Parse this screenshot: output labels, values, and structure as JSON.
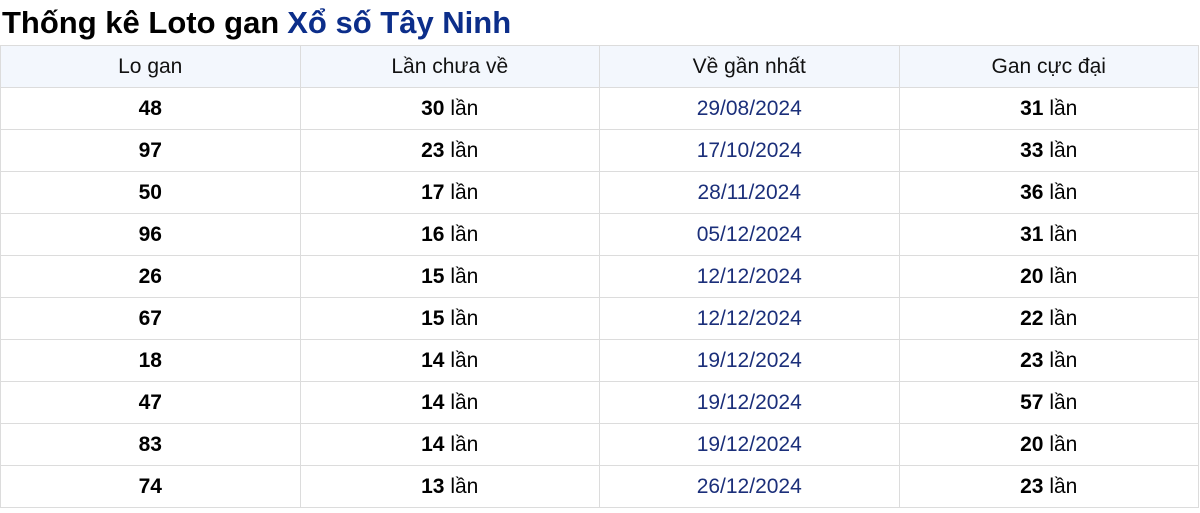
{
  "title": {
    "prefix": "Thống kê Loto gan",
    "link": "Xổ số Tây Ninh"
  },
  "colors": {
    "link": "#0c2e8a",
    "date": "#1b2f7a",
    "header_bg": "#f3f7fd",
    "border": "#dcdcdc"
  },
  "table": {
    "headers": [
      "Lo gan",
      "Lần chưa về",
      "Về gần nhất",
      "Gan cực đại"
    ],
    "unit": "lần",
    "rows": [
      {
        "lo": "48",
        "chua_ve": "30",
        "ve_gan_nhat": "29/08/2024",
        "gan_cuc_dai": "31"
      },
      {
        "lo": "97",
        "chua_ve": "23",
        "ve_gan_nhat": "17/10/2024",
        "gan_cuc_dai": "33"
      },
      {
        "lo": "50",
        "chua_ve": "17",
        "ve_gan_nhat": "28/11/2024",
        "gan_cuc_dai": "36"
      },
      {
        "lo": "96",
        "chua_ve": "16",
        "ve_gan_nhat": "05/12/2024",
        "gan_cuc_dai": "31"
      },
      {
        "lo": "26",
        "chua_ve": "15",
        "ve_gan_nhat": "12/12/2024",
        "gan_cuc_dai": "20"
      },
      {
        "lo": "67",
        "chua_ve": "15",
        "ve_gan_nhat": "12/12/2024",
        "gan_cuc_dai": "22"
      },
      {
        "lo": "18",
        "chua_ve": "14",
        "ve_gan_nhat": "19/12/2024",
        "gan_cuc_dai": "23"
      },
      {
        "lo": "47",
        "chua_ve": "14",
        "ve_gan_nhat": "19/12/2024",
        "gan_cuc_dai": "57"
      },
      {
        "lo": "83",
        "chua_ve": "14",
        "ve_gan_nhat": "19/12/2024",
        "gan_cuc_dai": "20"
      },
      {
        "lo": "74",
        "chua_ve": "13",
        "ve_gan_nhat": "26/12/2024",
        "gan_cuc_dai": "23"
      }
    ]
  }
}
